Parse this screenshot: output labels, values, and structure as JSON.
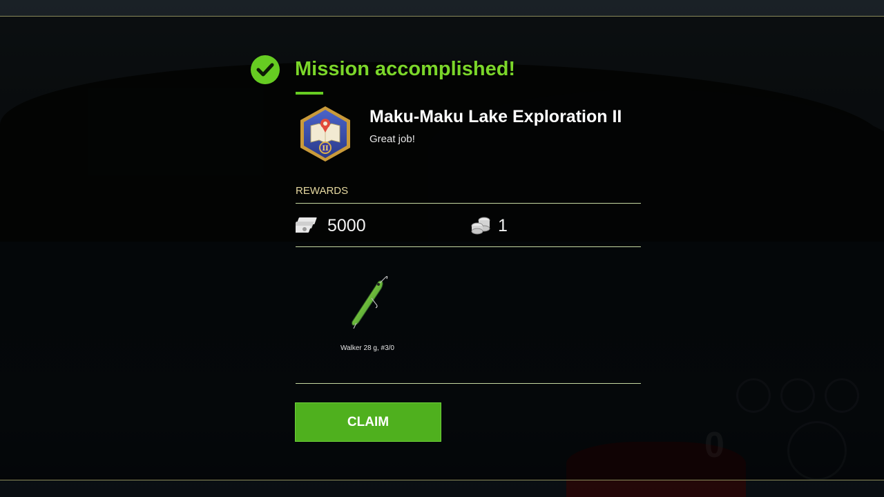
{
  "mission": {
    "status_title": "Mission accomplished!",
    "name": "Maku-Maku Lake Exploration II",
    "subtitle": "Great job!",
    "badge_numeral": "II"
  },
  "rewards": {
    "label": "REWARDS",
    "money_value": "5000",
    "coins_value": "1",
    "items": [
      {
        "name": "Walker 28 g, #3/0",
        "icon": "lure-icon"
      }
    ]
  },
  "actions": {
    "claim_label": "CLAIM"
  },
  "colors": {
    "accent_green": "#7bd62a",
    "claim_button": "#4fb01e",
    "rewards_label": "#e6d9a0",
    "divider": "#c7d9a2"
  }
}
